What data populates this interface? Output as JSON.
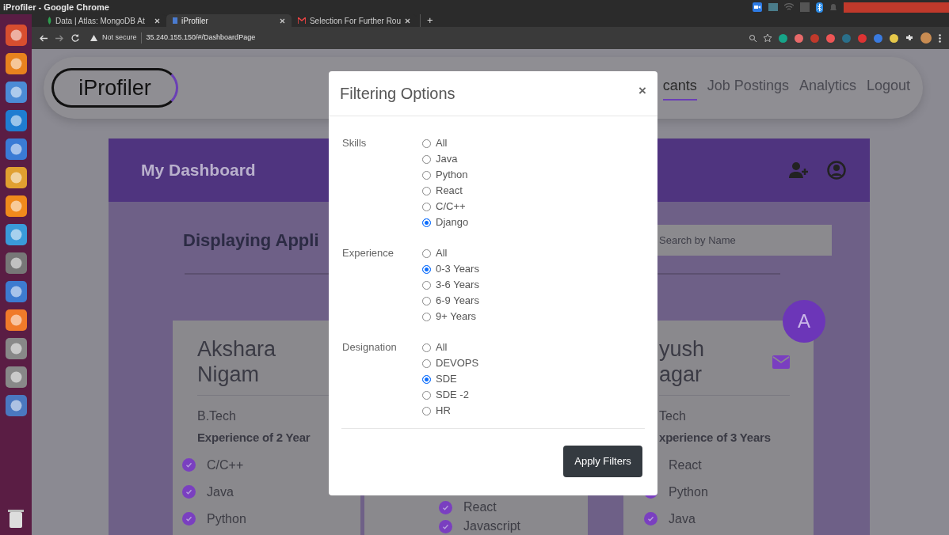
{
  "os_bar": {
    "title": "iProfiler - Google Chrome"
  },
  "browser": {
    "tabs": [
      {
        "title": "Data | Atlas: MongoDB At",
        "selected": false,
        "kind": "leaf"
      },
      {
        "title": "iProfiler",
        "selected": true,
        "kind": "page"
      },
      {
        "title": "Selection For Further Rou",
        "selected": false,
        "kind": "mail"
      }
    ],
    "new_tab": "+",
    "security": "Not secure",
    "url": "35.240.155.150/#/DashboardPage"
  },
  "navbar": {
    "logo": "iProfiler",
    "links": [
      {
        "label": "cants",
        "selected": true
      },
      {
        "label": "Job Postings",
        "selected": false
      },
      {
        "label": "Analytics",
        "selected": false
      },
      {
        "label": "Logout",
        "selected": false
      }
    ]
  },
  "dashboard": {
    "title": "My Dashboard",
    "heading": "Displaying Appli",
    "search": {
      "placeholder": "Search by Name"
    }
  },
  "cards": [
    {
      "name_lines": [
        "Akshara",
        "Nigam"
      ],
      "degree": "B.Tech",
      "experience": "Experience of 2 Year",
      "skills": [
        "C/C++",
        "Java",
        "Python"
      ]
    },
    {
      "skills": [
        "React",
        "Javascript"
      ]
    },
    {
      "avatar": "A",
      "name_lines": [
        "yush",
        "agar"
      ],
      "degree": "Tech",
      "experience": "xperience of 3 Years",
      "skills": [
        "React",
        "Python",
        "Java"
      ]
    }
  ],
  "modal": {
    "title": "Filtering Options",
    "close": "×",
    "groups": [
      {
        "label": "Skills",
        "options": [
          {
            "label": "All",
            "selected": false
          },
          {
            "label": "Java",
            "selected": false
          },
          {
            "label": "Python",
            "selected": false
          },
          {
            "label": "React",
            "selected": false
          },
          {
            "label": "C/C++",
            "selected": false
          },
          {
            "label": "Django",
            "selected": true
          }
        ]
      },
      {
        "label": "Experience",
        "options": [
          {
            "label": "All",
            "selected": false
          },
          {
            "label": "0-3 Years",
            "selected": true
          },
          {
            "label": "3-6 Years",
            "selected": false
          },
          {
            "label": "6-9 Years",
            "selected": false
          },
          {
            "label": "9+ Years",
            "selected": false
          }
        ]
      },
      {
        "label": "Designation",
        "options": [
          {
            "label": "All",
            "selected": false
          },
          {
            "label": "DEVOPS",
            "selected": false
          },
          {
            "label": "SDE",
            "selected": true
          },
          {
            "label": "SDE -2",
            "selected": false
          },
          {
            "label": "HR",
            "selected": false
          }
        ]
      }
    ],
    "apply": "Apply Filters"
  }
}
